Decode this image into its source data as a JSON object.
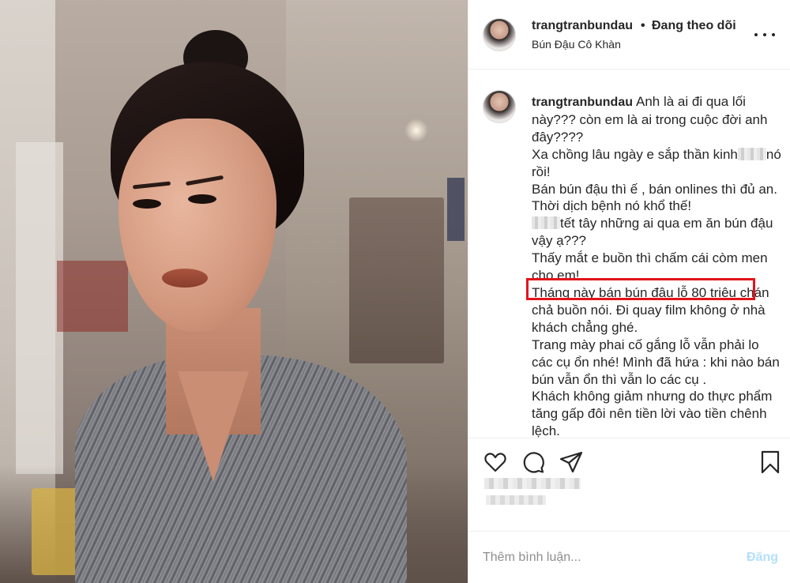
{
  "post": {
    "username": "trangtranbundau",
    "separator": "•",
    "follow_label": "Đang theo dõi",
    "location": "Bún Đậu Cô Khàn"
  },
  "caption": {
    "username": "trangtranbundau",
    "line1": "Anh là ai đi qua lối này??? còn em là ai trong cuộc đời anh đây????",
    "line2a": "Xa chồng lâu ngày e sắp thần kinh",
    "line2b": "nó rồi!",
    "line3": "Bán bún đậu thì ế , bán onlines thì đủ an. Thời dịch bệnh nó khổ thế!",
    "line4": "tết tây những ai qua em ăn bún đậu vậy ạ???",
    "line5": "Thấy mắt e buồn thì chấm cái còm men cho em!",
    "line6": "Tháng này bán bún đậu lỗ 80 triệu chán chả buồn nói. Đi quay film không ở nhà khách chẳng ghé.",
    "line7": "Trang mày phai cố gắng lỗ vẫn phải lo các cụ ổn nhé! Mình đã hứa : khi nào bán bún vẫn ổn thì vẫn lo các cụ .",
    "line8": "Khách không giảm nhưng do thực phẩm tăng gấp đôi nên tiền lời vào tiền chênh lệch."
  },
  "actions": {
    "like_icon": "heart-icon",
    "comment_icon": "comment-bubble-icon",
    "share_icon": "paper-plane-icon",
    "save_icon": "bookmark-icon"
  },
  "comment_box": {
    "placeholder": "Thêm bình luận...",
    "post_label": "Đăng"
  },
  "colors": {
    "highlight_border": "#e3141b",
    "post_button_disabled": "#b2dffc",
    "divider": "#efefef"
  }
}
